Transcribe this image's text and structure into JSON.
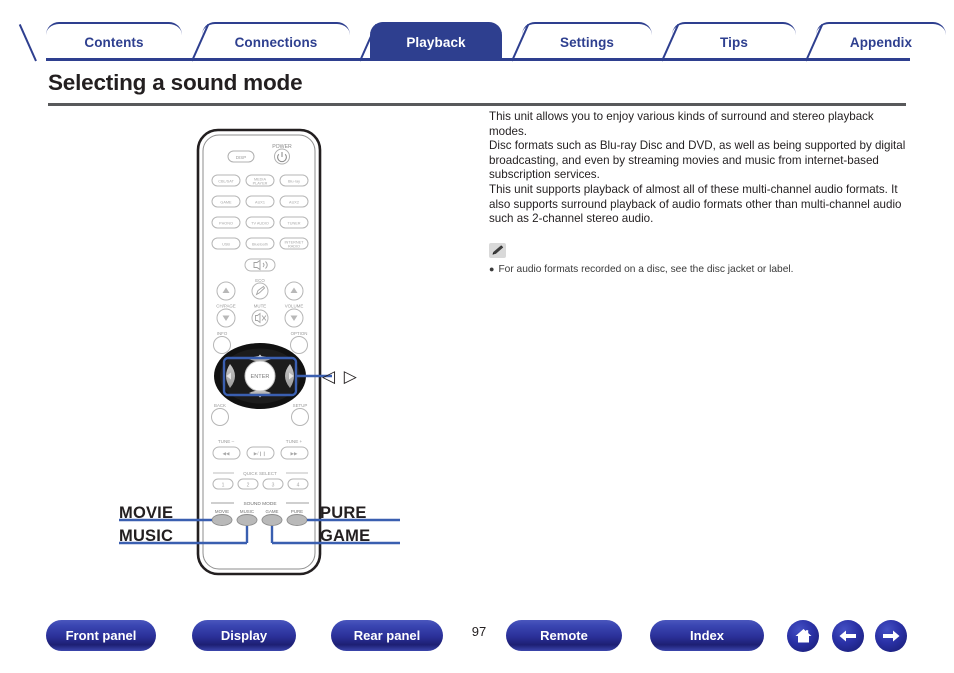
{
  "colors": {
    "brand_blue": "#2e3f8f",
    "callout_blue": "#3a5fb0",
    "text_dark": "#231f20",
    "rule_gray": "#58595b",
    "note_bg": "#d9d9d9"
  },
  "tabs": [
    {
      "label": "Contents",
      "active": false
    },
    {
      "label": "Connections",
      "active": false
    },
    {
      "label": "Playback",
      "active": true
    },
    {
      "label": "Settings",
      "active": false
    },
    {
      "label": "Tips",
      "active": false
    },
    {
      "label": "Appendix",
      "active": false
    }
  ],
  "page": {
    "title": "Selecting a sound mode",
    "number": "97"
  },
  "body": {
    "paragraphs": [
      "This unit allows you to enjoy various kinds of surround and stereo playback modes.",
      "Disc formats such as Blu-ray Disc and DVD, as well as being supported by digital broadcasting, and even by streaming movies and music from internet-based subscription services.",
      "This unit supports playback of almost all of these multi-channel audio formats. It also supports surround playback of audio formats other than multi-channel audio such as 2-channel stereo audio."
    ]
  },
  "note": {
    "icon": "pencil-icon",
    "items": [
      "For audio formats recorded on a disc, see the disc jacket or label."
    ]
  },
  "figure": {
    "device": "remote-control",
    "callouts": {
      "movie": "MOVIE",
      "music": "MUSIC",
      "pure": "PURE",
      "game": "GAME",
      "cursor_keys": "◁ ▷"
    },
    "remote": {
      "power_label": "POWER",
      "disp_label": "DISP",
      "source_buttons": [
        "CBL/SAT",
        "MEDIA PLAYER",
        "Blu-ray",
        "GAME",
        "AUX1",
        "AUX2",
        "PHONO",
        "TV AUDIO",
        "TUNER",
        "USB",
        "Bluetooth",
        "INTERNET RADIO"
      ],
      "eco_label": "ECO",
      "mute_label": "MUTE",
      "volume_label": "VOLUME",
      "chpage_label": "CH/PAGE",
      "info_label": "INFO",
      "option_label": "OPTION",
      "enter_label": "ENTER",
      "back_label": "BACK",
      "setup_label": "SETUP",
      "tune_minus_label": "TUNE –",
      "tune_plus_label": "TUNE +",
      "quick_select_label": "QUICK SELECT",
      "quick_select_numbers": [
        "1",
        "2",
        "3",
        "4"
      ],
      "sound_mode_label": "SOUND MODE",
      "sound_mode_buttons": [
        "MOVIE",
        "MUSIC",
        "GAME",
        "PURE"
      ]
    }
  },
  "footer": {
    "buttons": [
      {
        "label": "Front panel"
      },
      {
        "label": "Display"
      },
      {
        "label": "Rear panel"
      },
      {
        "label": "Remote"
      },
      {
        "label": "Index"
      }
    ],
    "icons": [
      {
        "name": "home-icon"
      },
      {
        "name": "arrow-left-icon"
      },
      {
        "name": "arrow-right-icon"
      }
    ]
  }
}
